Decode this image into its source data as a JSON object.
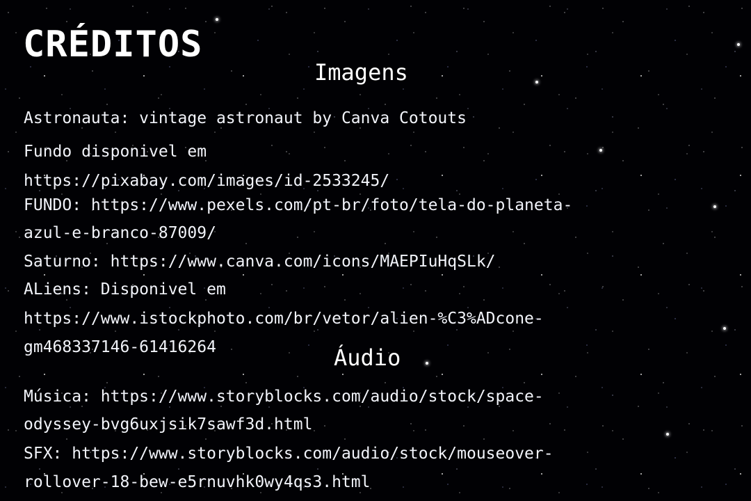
{
  "screen": {
    "title": "CRÉDITOS",
    "background": "starfield",
    "text_color": "#f2f4fa"
  },
  "images": {
    "heading": "Imagens",
    "lines": [
      "Astronauta: vintage astronaut by Canva Cotouts",
      "Fundo disponivel em",
      "https://pixabay.com/images/id-2533245/",
      "FUNDO:  https://www.pexels.com/pt-br/foto/tela-do-planeta-",
      "azul-e-branco-87009/",
      "Saturno: https://www.canva.com/icons/MAEPIuHqSLk/",
      "ALiens: Disponivel em",
      "https://www.istockphoto.com/br/vetor/alien-%C3%ADcone-",
      "gm468337146-61416264"
    ]
  },
  "audio": {
    "heading": "Áudio",
    "lines": [
      "Música: https://www.storyblocks.com/audio/stock/space-",
      "odyssey-bvg6uxjsik7sawf3d.html",
      "SFX: https://www.storyblocks.com/audio/stock/mouseover-",
      "rollover-18-bew-e5rnuvhk0wy4qs3.html"
    ]
  }
}
